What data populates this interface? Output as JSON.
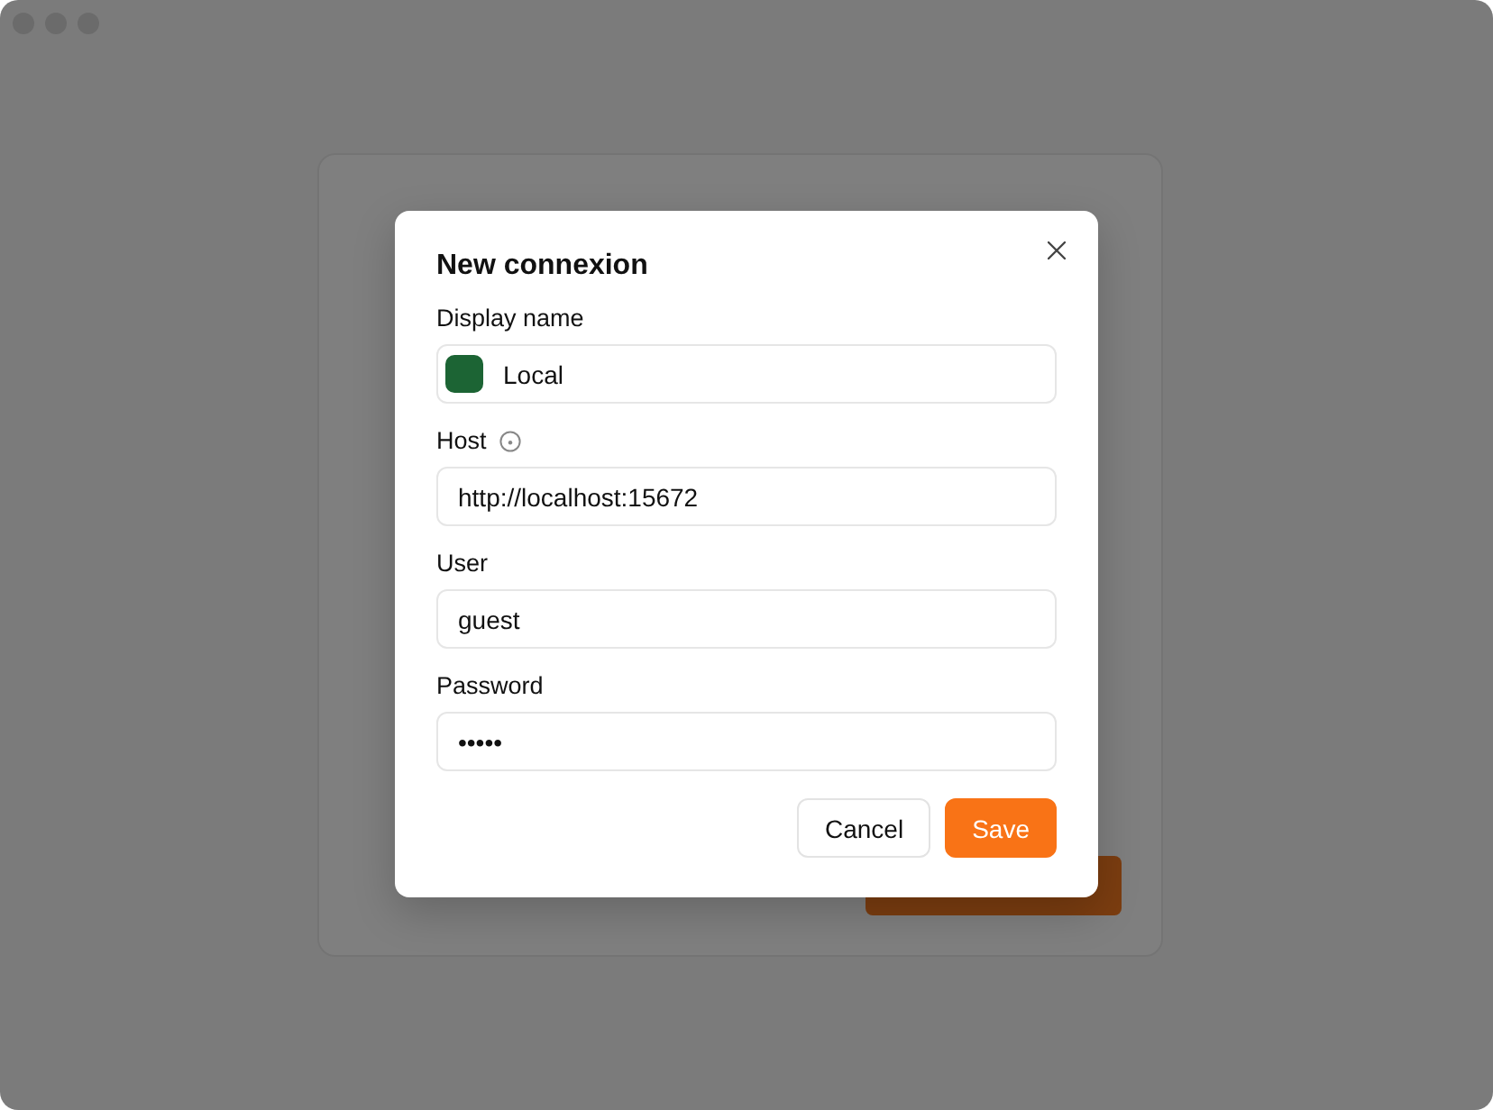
{
  "dialog": {
    "title": "New connexion",
    "fields": [
      {
        "label": "Display name",
        "value": "Local",
        "color": "#1c6434",
        "info": false
      },
      {
        "label": "Host",
        "value": "http://localhost:15672",
        "info": true
      },
      {
        "label": "User",
        "value": "guest",
        "info": false
      },
      {
        "label": "Password",
        "value": "•••••",
        "info": false
      }
    ],
    "buttons": [
      {
        "label": "Cancel",
        "primary": false
      },
      {
        "label": "Save",
        "primary": true
      }
    ]
  }
}
